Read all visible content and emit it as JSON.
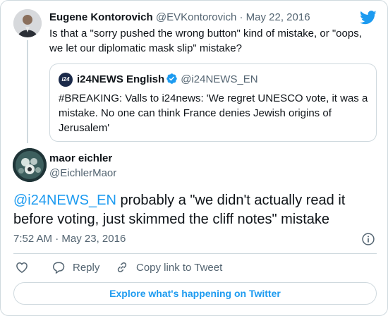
{
  "parent": {
    "name": "Eugene Kontorovich",
    "handle": "@EVKontorovich",
    "separator": "·",
    "date": "May 22, 2016",
    "text": "Is that a \"sorry pushed the wrong button\" kind of mistake, or \"oops, we let our diplomatic mask slip\" mistake?"
  },
  "quote": {
    "avatar_text": "i24",
    "name": "i24NEWS English",
    "handle": "@i24NEWS_EN",
    "text": "#BREAKING: Valls to i24news: 'We regret UNESCO vote, it was a mistake. No one can think France denies Jewish origins of Jerusalem'"
  },
  "tweet": {
    "name": "maor eichler",
    "handle": "@EichlerMaor",
    "mention": "@i24NEWS_EN",
    "text": " probably a \"we didn't actually read it before voting, just skimmed the cliff notes\" mistake",
    "time": "7:52 AM",
    "separator": "·",
    "date": "May 23, 2016"
  },
  "actions": {
    "reply": "Reply",
    "copy_link": "Copy link to Tweet"
  },
  "explore_label": "Explore what's happening on Twitter",
  "colors": {
    "accent": "#1d9bf0",
    "secondary_text": "#536471",
    "border": "#cfd9de"
  },
  "icons": [
    "twitter-bird-icon",
    "verified-badge-icon",
    "info-icon",
    "heart-icon",
    "reply-bubble-icon",
    "link-icon"
  ]
}
